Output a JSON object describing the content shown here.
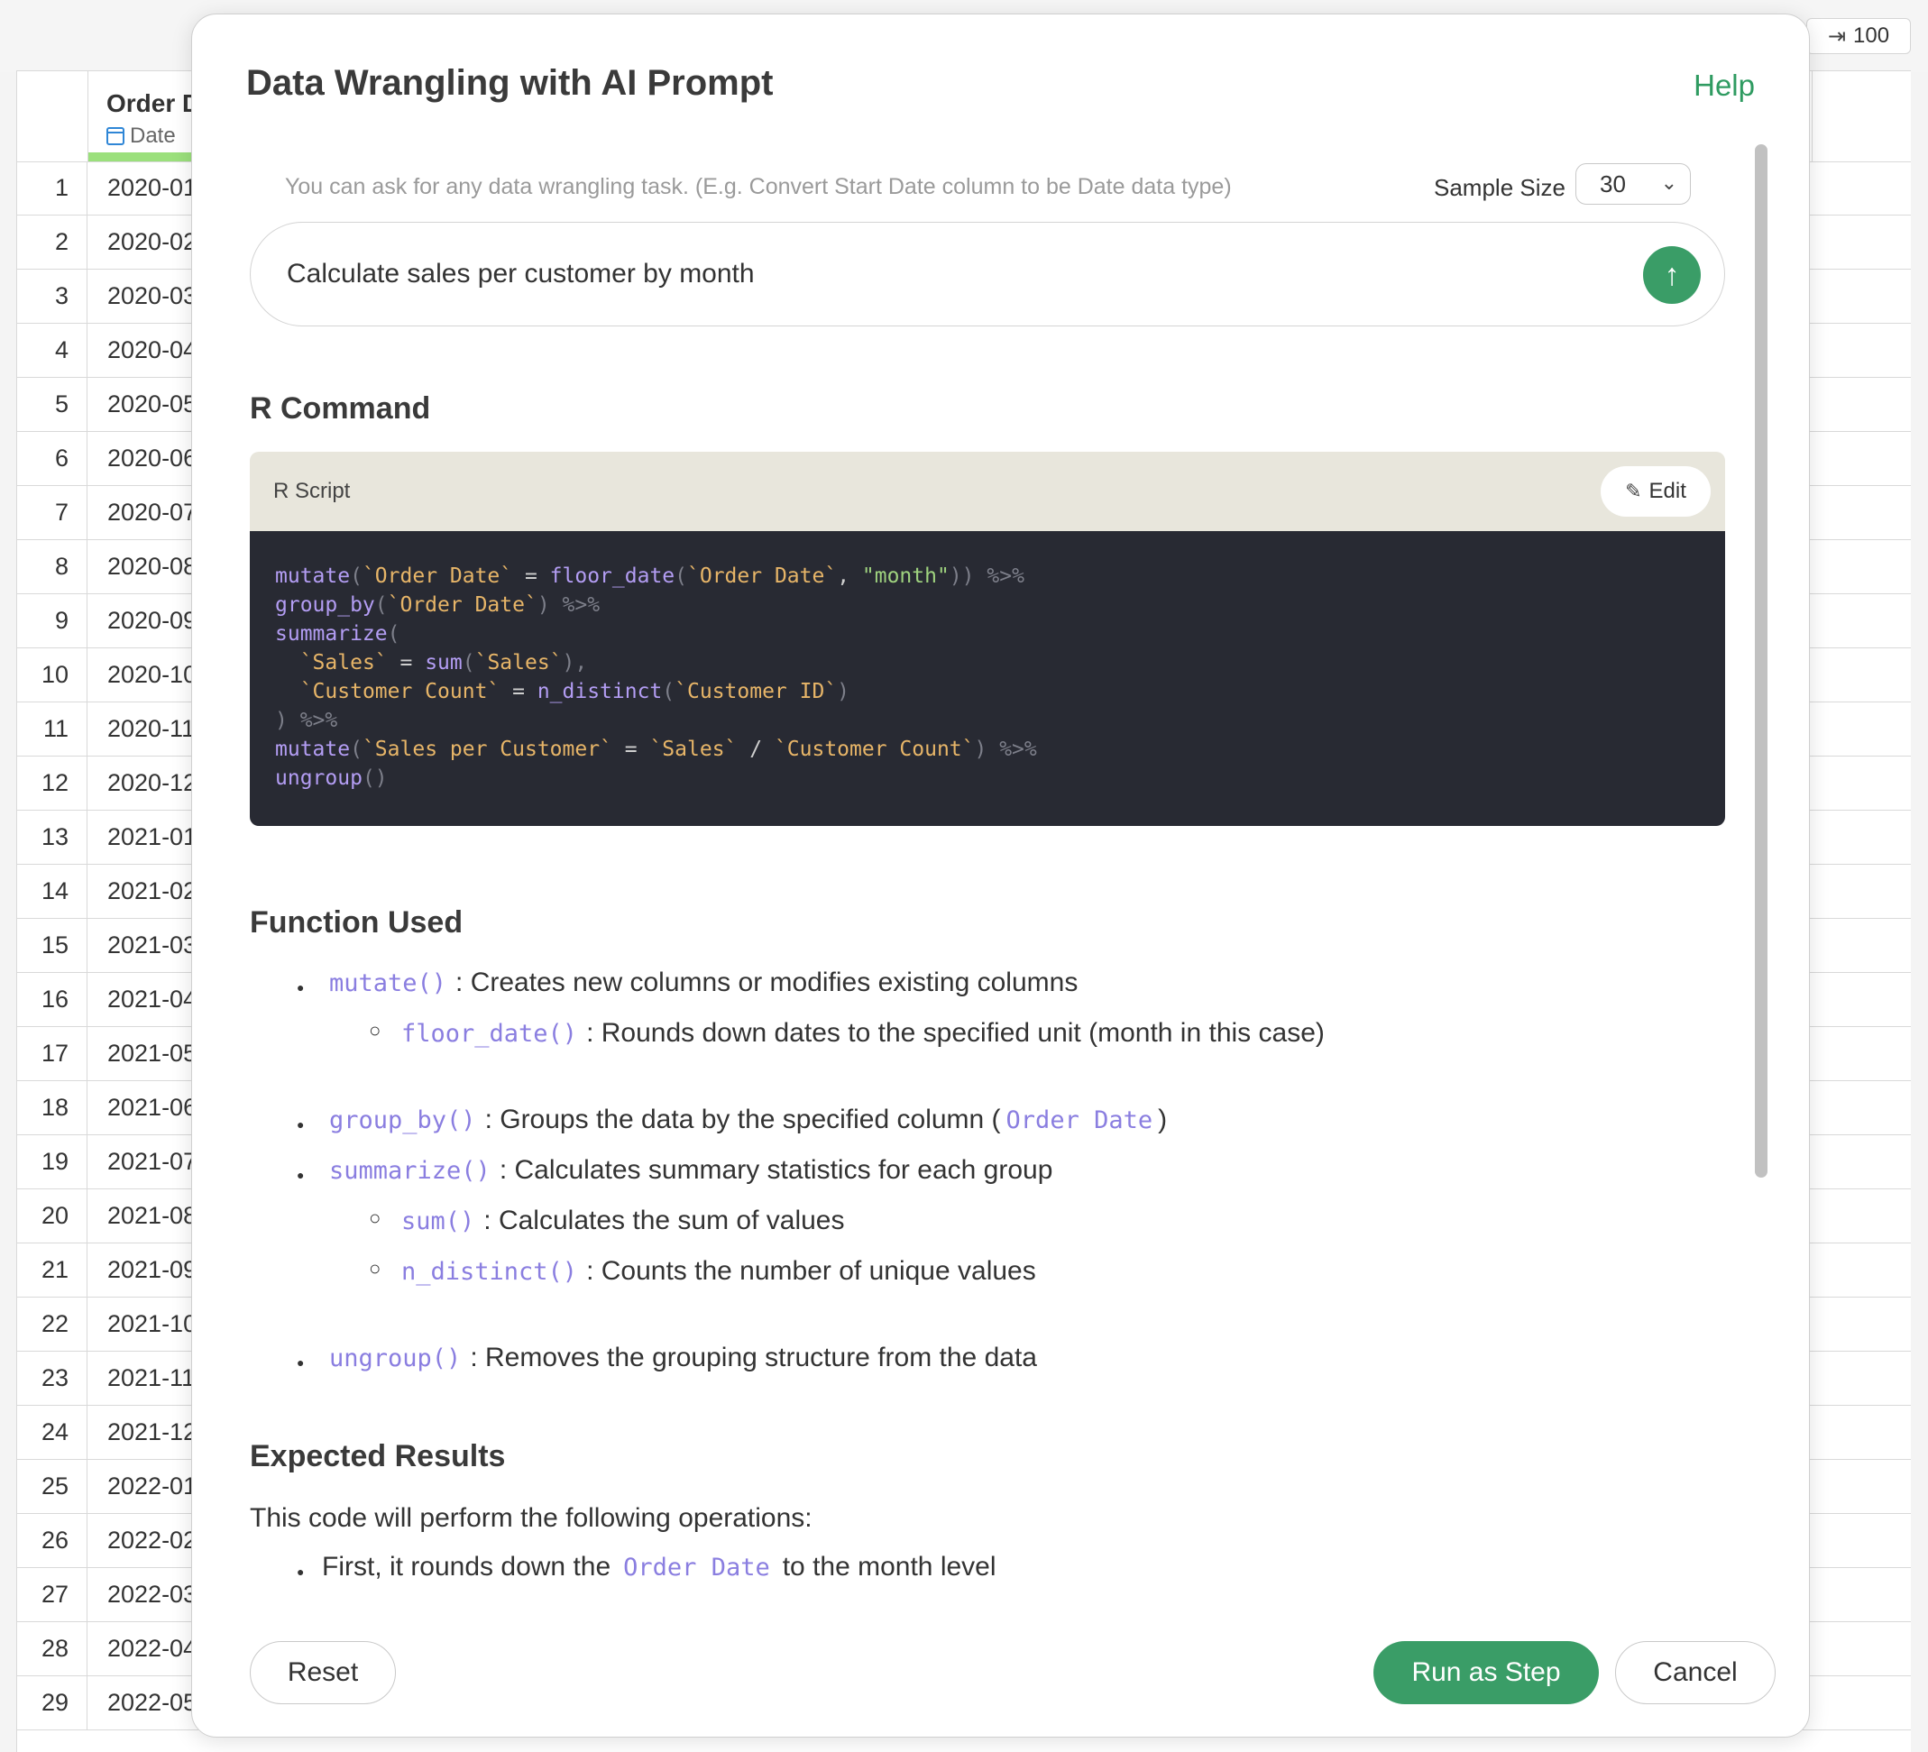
{
  "toolbar": {
    "row_limit": "100",
    "row_limit_icon": "arrow-to-end-icon"
  },
  "grid": {
    "column": {
      "name": "Order D",
      "type": "Date"
    },
    "rows": [
      {
        "i": "1",
        "v": "2020-01"
      },
      {
        "i": "2",
        "v": "2020-02"
      },
      {
        "i": "3",
        "v": "2020-03"
      },
      {
        "i": "4",
        "v": "2020-04"
      },
      {
        "i": "5",
        "v": "2020-05"
      },
      {
        "i": "6",
        "v": "2020-06"
      },
      {
        "i": "7",
        "v": "2020-07"
      },
      {
        "i": "8",
        "v": "2020-08"
      },
      {
        "i": "9",
        "v": "2020-09"
      },
      {
        "i": "10",
        "v": "2020-10"
      },
      {
        "i": "11",
        "v": "2020-11"
      },
      {
        "i": "12",
        "v": "2020-12"
      },
      {
        "i": "13",
        "v": "2021-01"
      },
      {
        "i": "14",
        "v": "2021-02"
      },
      {
        "i": "15",
        "v": "2021-03"
      },
      {
        "i": "16",
        "v": "2021-04"
      },
      {
        "i": "17",
        "v": "2021-05"
      },
      {
        "i": "18",
        "v": "2021-06"
      },
      {
        "i": "19",
        "v": "2021-07"
      },
      {
        "i": "20",
        "v": "2021-08"
      },
      {
        "i": "21",
        "v": "2021-09"
      },
      {
        "i": "22",
        "v": "2021-10"
      },
      {
        "i": "23",
        "v": "2021-11"
      },
      {
        "i": "24",
        "v": "2021-12"
      },
      {
        "i": "25",
        "v": "2022-01"
      },
      {
        "i": "26",
        "v": "2022-02"
      },
      {
        "i": "27",
        "v": "2022-03"
      },
      {
        "i": "28",
        "v": "2022-04"
      },
      {
        "i": "29",
        "v": "2022-05"
      }
    ]
  },
  "modal": {
    "title": "Data Wrangling with AI Prompt",
    "help": "Help",
    "hint": "You can ask for any data wrangling task. (E.g. Convert Start Date column to be Date data type)",
    "sample_size_label": "Sample Size",
    "sample_size_value": "30",
    "prompt": "Calculate sales per customer by month",
    "r_command_title": "R Command",
    "script_label": "R Script",
    "edit_label": "Edit",
    "function_used_title": "Function Used",
    "functions": {
      "mutate": {
        "code": "mutate()",
        "desc": ": Creates new columns or modifies existing columns"
      },
      "floor_date": {
        "code": "floor_date()",
        "desc": ": Rounds down dates to the specified unit (month in this case)"
      },
      "group_by": {
        "code": "group_by()",
        "desc_pre": ": Groups the data by the specified column (",
        "arg": "Order Date",
        "desc_post": ")"
      },
      "summarize": {
        "code": "summarize()",
        "desc": ": Calculates summary statistics for each group"
      },
      "sum": {
        "code": "sum()",
        "desc": ": Calculates the sum of values"
      },
      "n_distinct": {
        "code": "n_distinct()",
        "desc": ": Counts the number of unique values"
      },
      "ungroup": {
        "code": "ungroup()",
        "desc": ": Removes the grouping structure from the data"
      }
    },
    "expected_title": "Expected Results",
    "expected_intro": "This code will perform the following operations:",
    "expected_item1_pre": "First, it rounds down the",
    "expected_item1_code": "Order Date",
    "expected_item1_post": "to the month level",
    "buttons": {
      "reset": "Reset",
      "run": "Run as Step",
      "cancel": "Cancel"
    }
  },
  "code": {
    "l1_fn1": "mutate",
    "l1_p1": "(",
    "l1_col1": "`Order Date`",
    "l1_eq": " = ",
    "l1_fn2": "floor_date",
    "l1_p2": "(",
    "l1_col2": "`Order Date`",
    "l1_comma": ", ",
    "l1_str": "\"month\"",
    "l1_close": "))",
    "l1_pipe": " %>%",
    "l2_fn": "group_by",
    "l2_p1": "(",
    "l2_col": "`Order Date`",
    "l2_close": ")",
    "l2_pipe": " %>%",
    "l3_fn": "summarize",
    "l3_p": "(",
    "l4_ind": "  ",
    "l4_col": "`Sales`",
    "l4_eq": " = ",
    "l4_fn": "sum",
    "l4_p": "(",
    "l4_arg": "`Sales`",
    "l4_close": "),",
    "l5_ind": "  ",
    "l5_col": "`Customer Count`",
    "l5_eq": " = ",
    "l5_fn": "n_distinct",
    "l5_p": "(",
    "l5_arg": "`Customer ID`",
    "l5_close": ")",
    "l6_close": ")",
    "l6_pipe": " %>%",
    "l7_fn": "mutate",
    "l7_p": "(",
    "l7_col": "`Sales per Customer`",
    "l7_eq": " = ",
    "l7_a": "`Sales`",
    "l7_div": " / ",
    "l7_b": "`Customer Count`",
    "l7_close": ")",
    "l7_pipe": " %>%",
    "l8_fn": "ungroup",
    "l8_p": "()"
  },
  "colors": {
    "accent": "#3a9d67",
    "code_bg": "#282a33",
    "fn": "#b39df3",
    "backtick": "#e7b568",
    "string": "#9fd37f"
  }
}
